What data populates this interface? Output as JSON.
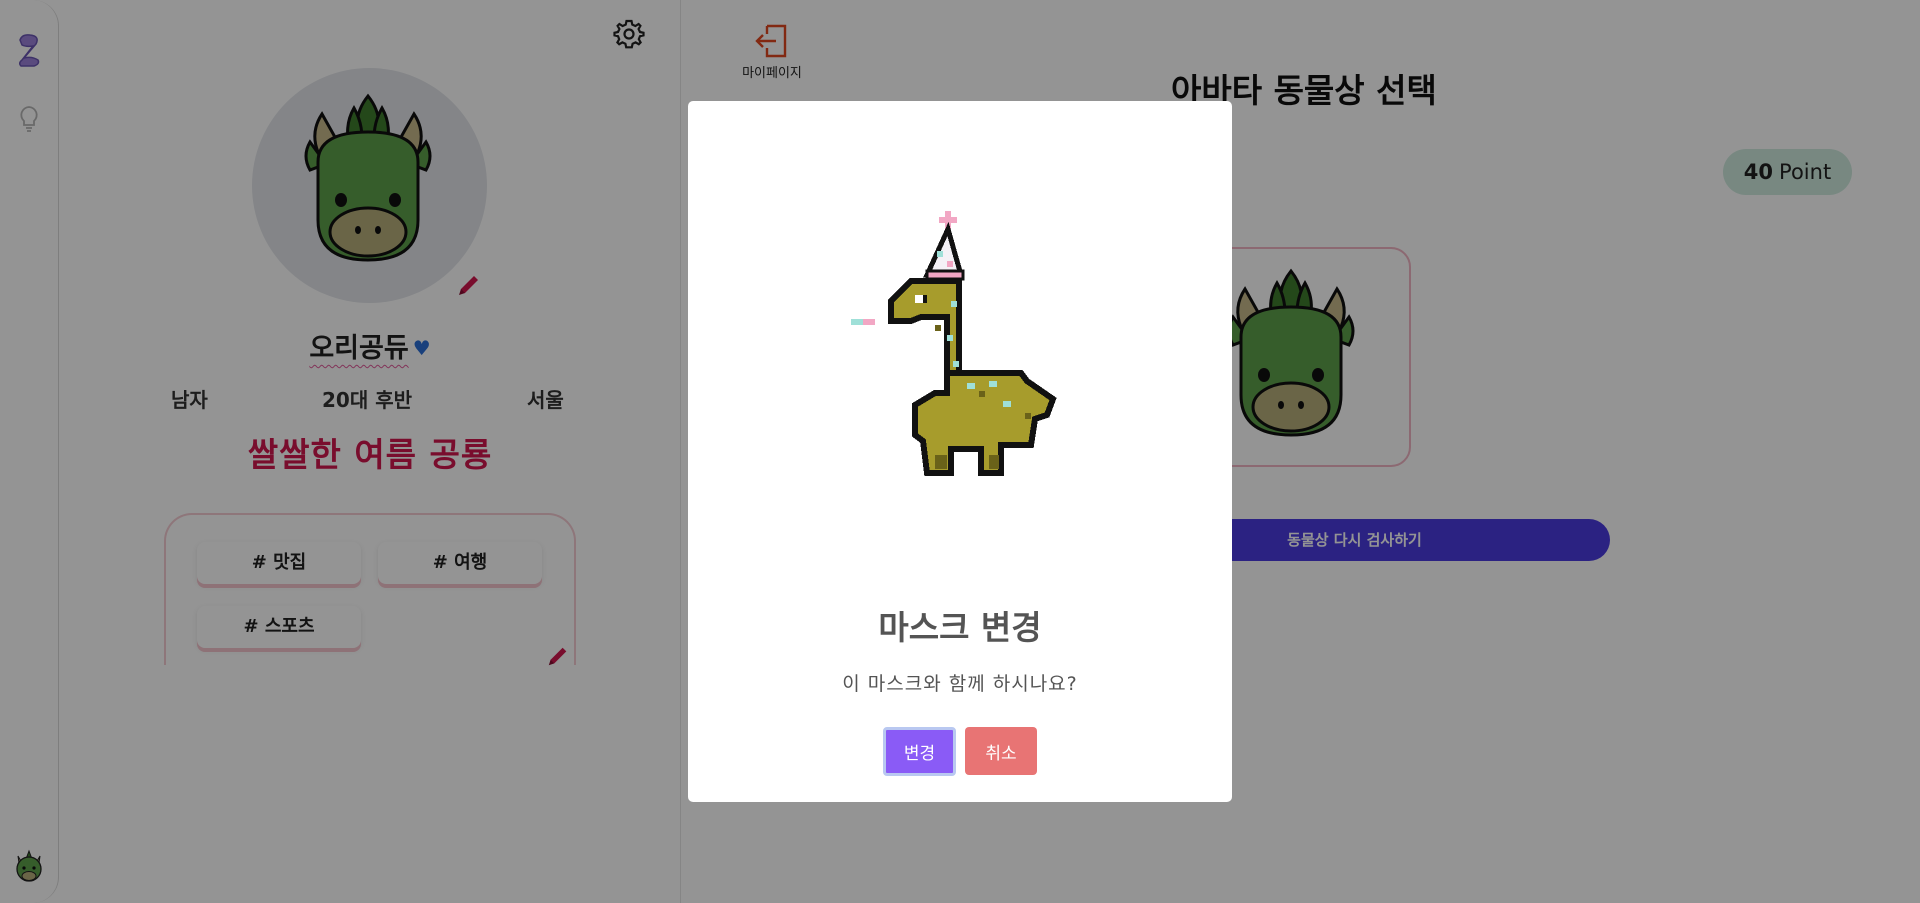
{
  "profile": {
    "nickname": "오리공듀",
    "gender": "남자",
    "age": "20대 후반",
    "region": "서울",
    "tagline": "쌀쌀한 여름 공룡",
    "interests": [
      "# 맛집",
      "# 여행",
      "# 스포츠"
    ]
  },
  "main": {
    "mypage_label": "마이페이지",
    "title": "아바타 동물상 선택",
    "points_value": "40",
    "points_unit": "Point",
    "retest_label": "동물상 다시 검사하기"
  },
  "modal": {
    "title": "마스크 변경",
    "text": "이 마스크와 함께 하시나요?",
    "confirm_label": "변경",
    "cancel_label": "취소"
  },
  "colors": {
    "accent_red": "#d1184f",
    "heart_blue": "#2b6fd6",
    "retest_button": "#4a3be0",
    "point_badge": "#cfeadf",
    "confirm_button": "#8a5bf6",
    "cancel_button": "#e87474"
  },
  "icons": {
    "rail_logo": "z-logo-icon",
    "rail_tip": "lightbulb-icon",
    "settings": "gear-icon",
    "edit": "pencil-icon",
    "mypage": "exit-door-icon",
    "heart": "heart-icon"
  }
}
